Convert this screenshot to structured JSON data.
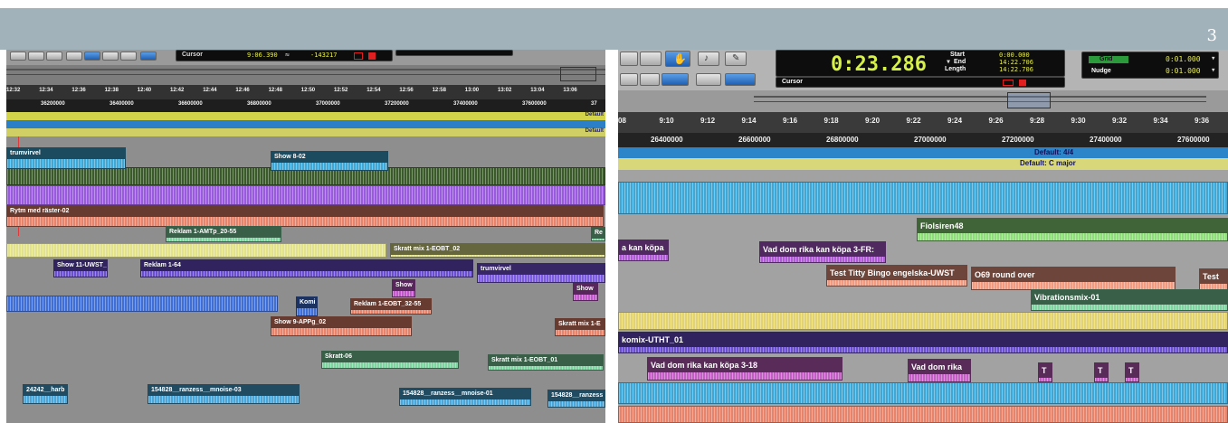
{
  "slide": {
    "page_number": "3"
  },
  "left": {
    "toolbar": {
      "cursor_label": "Cursor",
      "cursor_value": "9:06.390",
      "cursor_samples": "-143217"
    },
    "timeline_ticks": [
      "12:32",
      "12:34",
      "12:36",
      "12:38",
      "12:40",
      "12:42",
      "12:44",
      "12:46",
      "12:48",
      "12:50",
      "12:52",
      "12:54",
      "12:56",
      "12:58",
      "13:00",
      "13:02",
      "13:04",
      "13:06"
    ],
    "sample_ticks": [
      "36200000",
      "36400000",
      "36600000",
      "36800000",
      "37000000",
      "37200000",
      "37400000",
      "37600000",
      "37"
    ],
    "marker_default_1": "Default",
    "marker_default_2": "Default",
    "clips": [
      {
        "label": "trumvirvel",
        "color": "#3fa7d6"
      },
      {
        "label": "Show 8-02",
        "color": "#3fa7d6"
      },
      {
        "label": "Rytm med räster-02",
        "color": "#e7836a"
      },
      {
        "label": "Reklam 1-AMTp_20-55",
        "color": "#7fd3a1"
      },
      {
        "label": "Re",
        "color": "#7fd3a1"
      },
      {
        "label": "Skratt mix 1-EOBT_02",
        "color": "#e2e28a"
      },
      {
        "label": "Show 11-UWST_",
        "color": "#6a4fd0"
      },
      {
        "label": "Reklam 1-64",
        "color": "#6a4fd0"
      },
      {
        "label": "trumvirvel",
        "color": "#7a5ae0"
      },
      {
        "label": "Show",
        "color": "#c058c9"
      },
      {
        "label": "Show",
        "color": "#c058c9"
      },
      {
        "label": "Komi",
        "color": "#3f6fd6"
      },
      {
        "label": "Reklam 1-EOBT_32-55",
        "color": "#e7836a"
      },
      {
        "label": "Show 9-APPg_02",
        "color": "#e7836a"
      },
      {
        "label": "Skratt mix 1-E",
        "color": "#e7836a"
      },
      {
        "label": "Skratt-06",
        "color": "#7fd3a1"
      },
      {
        "label": "Skratt mix 1-EOBT_01",
        "color": "#7fd3a1"
      },
      {
        "label": "24242__harb",
        "color": "#4aa6d8"
      },
      {
        "label": "154828__ranzess__mnoise-03",
        "color": "#4aa6d8"
      },
      {
        "label": "154828__ranzess__mnoise-01",
        "color": "#4aa6d8"
      },
      {
        "label": "154828__ranzess",
        "color": "#4aa6d8"
      }
    ]
  },
  "right": {
    "counter": {
      "main": "0:23.286",
      "start_label": "Start",
      "start_value": "0:00.000",
      "end_label": "End",
      "end_value": "14:22.706",
      "length_label": "Length",
      "length_value": "14:22.706"
    },
    "cursor_label": "Cursor",
    "grid": {
      "grid_label": "Grid",
      "grid_value": "0:01.000",
      "nudge_label": "Nudge",
      "nudge_value": "0:01.000"
    },
    "timeline_ticks": [
      "08",
      "9:10",
      "9:12",
      "9:14",
      "9:16",
      "9:18",
      "9:20",
      "9:22",
      "9:24",
      "9:26",
      "9:28",
      "9:30",
      "9:32",
      "9:34",
      "9:36"
    ],
    "sample_ticks": [
      "26400000",
      "26600000",
      "26800000",
      "27000000",
      "27200000",
      "27400000",
      "27600000"
    ],
    "meter_marker": "Default: 4/4",
    "key_marker": "Default: C major",
    "clips": [
      {
        "label": "Fiolsiren48",
        "color": "#8fdc7a"
      },
      {
        "label": "a kan köpa",
        "color": "#b05bd6"
      },
      {
        "label": "Vad dom rika kan köpa 3-FR:",
        "color": "#b05bd6"
      },
      {
        "label": "Test Titty Bingo engelska-UWST",
        "color": "#f29a80"
      },
      {
        "label": "O69 round over",
        "color": "#f29a80"
      },
      {
        "label": "Test",
        "color": "#f29a80"
      },
      {
        "label": "Vibrationsmix-01",
        "color": "#7fd3a1"
      },
      {
        "label": "komix-UTHT_01",
        "color": "#6a4fd0"
      },
      {
        "label": "Vad dom rika kan köpa 3-18",
        "color": "#c35fc4"
      },
      {
        "label": "Vad dom rika",
        "color": "#c35fc4"
      },
      {
        "label": "T",
        "color": "#c35fc4"
      },
      {
        "label": "T",
        "color": "#c35fc4"
      },
      {
        "label": "T",
        "color": "#c35fc4"
      }
    ]
  }
}
